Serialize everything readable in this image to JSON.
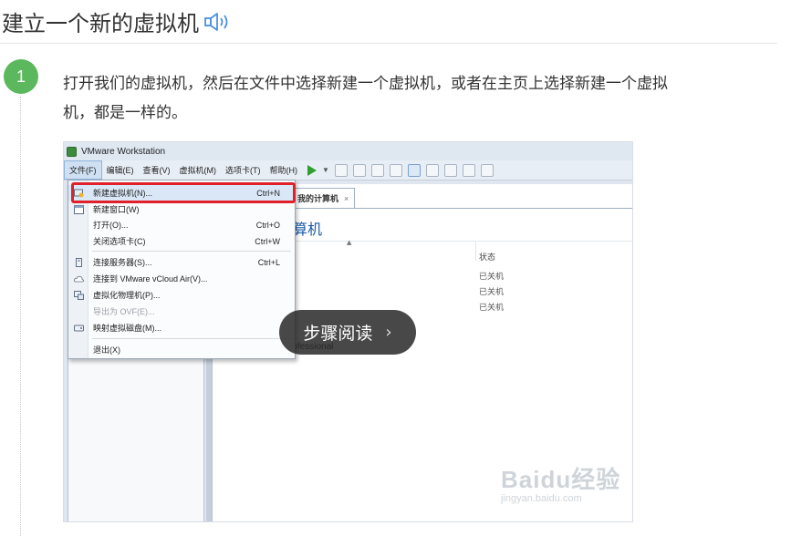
{
  "section": {
    "title": "建立一个新的虚拟机",
    "speaker_icon": "speaker-icon"
  },
  "step": {
    "number": "1",
    "line1": "打开我们的虚拟机，然后在文件中选择新建一个虚拟机，或者在主页上选择新建一个虚拟",
    "line2": "机，都是一样的。"
  },
  "screenshot": {
    "window_title": "VMware Workstation",
    "menu": [
      "文件(F)",
      "编辑(E)",
      "查看(V)",
      "虚拟机(M)",
      "选项卡(T)",
      "帮助(H)"
    ],
    "tab_label": "我的计算机",
    "tab_close": "×",
    "heading": "算机",
    "column_status": "状态",
    "partial_name": "rofessional",
    "statuses": [
      "已关机",
      "已关机",
      "已关机"
    ],
    "dropdown": [
      {
        "label": "新建虚拟机(N)...",
        "shortcut": "Ctrl+N",
        "icon": "new-vm-icon",
        "highlighted": true
      },
      {
        "label": "新建窗口(W)",
        "shortcut": "",
        "icon": "new-window-icon"
      },
      {
        "label": "打开(O)...",
        "shortcut": "Ctrl+O",
        "icon": ""
      },
      {
        "label": "关闭选项卡(C)",
        "shortcut": "Ctrl+W",
        "icon": ""
      },
      {
        "label": "连接服务器(S)...",
        "shortcut": "Ctrl+L",
        "icon": "server-icon"
      },
      {
        "label": "连接到 VMware vCloud Air(V)...",
        "shortcut": "",
        "icon": "cloud-icon"
      },
      {
        "label": "虚拟化物理机(P)...",
        "shortcut": "",
        "icon": "physical-machine-icon"
      },
      {
        "label": "导出为 OVF(E)...",
        "shortcut": "",
        "icon": "",
        "disabled": true
      },
      {
        "label": "映射虚拟磁盘(M)...",
        "shortcut": "",
        "icon": "disk-icon"
      },
      {
        "label": "退出(X)",
        "shortcut": "",
        "icon": ""
      }
    ],
    "watermark_big": "Baidu经验",
    "watermark_small": "jingyan.baidu.com"
  },
  "overlay": {
    "label": "步骤阅读",
    "chevron": "›"
  }
}
